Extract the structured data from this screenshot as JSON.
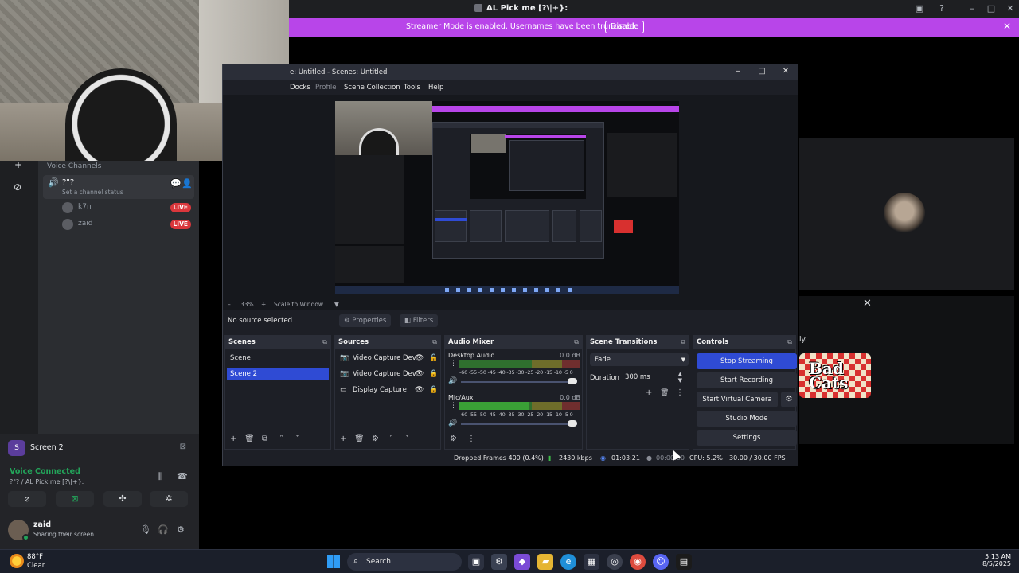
{
  "discord": {
    "window_title": "AL Pick me [?\\|+}:",
    "banner_text": "Streamer Mode is enabled. Usernames have been truncated.",
    "banner_button": "Disable",
    "voice_channels_header": "Voice Channels",
    "voice_channel": {
      "name": "?\"?",
      "status": "Set a channel status"
    },
    "users": [
      {
        "name": "k7n",
        "badge": "LIVE"
      },
      {
        "name": "zaid",
        "badge": "LIVE"
      }
    ],
    "screen_share_label": "Screen 2",
    "voice_connected": "Voice Connected",
    "voice_connected_sub": "?\"? / AL Pick me [?\\|+}:",
    "current_user": {
      "name": "zaid",
      "status": "Sharing their screen"
    },
    "more_text": "ly.",
    "game_logo_text": "Bad Cats"
  },
  "obs": {
    "window_title": "e: Untitled - Scenes: Untitled",
    "menu": [
      "Docks",
      "Profile",
      "Scene Collection",
      "Tools",
      "Help"
    ],
    "zoom": {
      "level": "33%",
      "mode": "Scale to Window"
    },
    "no_source": "No source selected",
    "properties_label": "Properties",
    "filters_label": "Filters",
    "scenes_title": "Scenes",
    "scenes": [
      "Scene",
      "Scene 2"
    ],
    "selected_scene_index": 1,
    "sources_title": "Sources",
    "sources": [
      {
        "name": "Video Capture Dev",
        "icon": "camera-icon"
      },
      {
        "name": "Video Capture Dev",
        "icon": "camera-icon"
      },
      {
        "name": "Display Capture",
        "icon": "monitor-icon"
      }
    ],
    "mixer_title": "Audio Mixer",
    "mixer": [
      {
        "name": "Desktop Audio",
        "db": "0.0 dB"
      },
      {
        "name": "Mic/Aux",
        "db": "0.0 dB"
      }
    ],
    "meter_scale": "-60 -55 -50 -45 -40 -35 -30 -25 -20 -15 -10 -5 0",
    "transitions_title": "Scene Transitions",
    "transition": "Fade",
    "duration_label": "Duration",
    "duration_value": "300 ms",
    "controls_title": "Controls",
    "controls": {
      "stop_streaming": "Stop Streaming",
      "start_recording": "Start Recording",
      "start_virtual_camera": "Start Virtual Camera",
      "studio_mode": "Studio Mode",
      "settings": "Settings"
    },
    "status": {
      "dropped_frames": "Dropped Frames 400 (0.4%)",
      "bitrate": "2430 kbps",
      "stream_time": "01:03:21",
      "rec_time": "00:00:00",
      "cpu": "CPU: 5.2%",
      "fps": "30.00 / 30.00 FPS"
    }
  },
  "taskbar": {
    "weather_temp": "88°F",
    "weather_cond": "Clear",
    "search_label": "Search",
    "time": "5:13 AM",
    "date": "8/5/2025"
  },
  "colors": {
    "accent": "#2f4bd4",
    "banner": "#b845e9",
    "live": "#da373c",
    "voice_green": "#23a55a"
  }
}
